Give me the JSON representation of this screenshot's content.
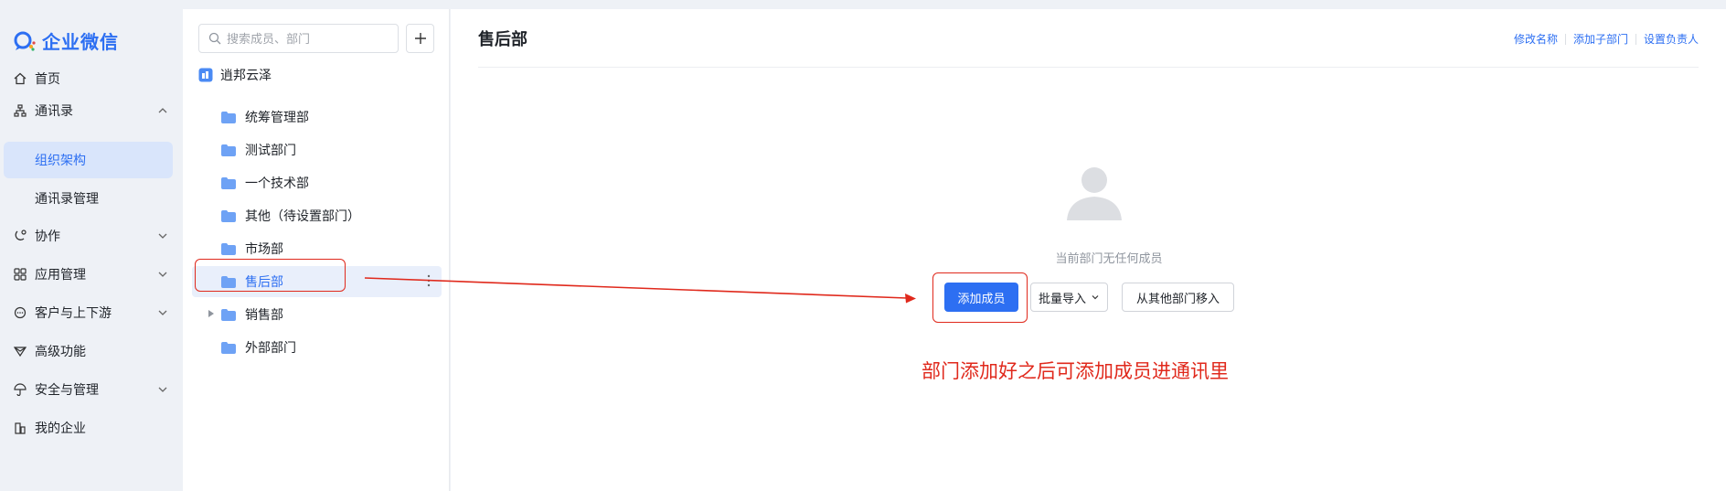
{
  "app": {
    "brand": "企业微信",
    "accent_color": "#2d6ff2",
    "annotation_color": "#e0291c"
  },
  "nav": {
    "items": [
      {
        "label": "首页",
        "icon": "home-icon"
      },
      {
        "label": "通讯录",
        "icon": "org-chart-icon",
        "expanded": true
      },
      {
        "label": "协作",
        "icon": "collaboration-icon"
      },
      {
        "label": "应用管理",
        "icon": "apps-grid-icon"
      },
      {
        "label": "客户与上下游",
        "icon": "chat-bubble-icon"
      },
      {
        "label": "高级功能",
        "icon": "diamond-icon"
      },
      {
        "label": "安全与管理",
        "icon": "umbrella-icon"
      },
      {
        "label": "我的企业",
        "icon": "building-icon"
      }
    ],
    "sub_items": [
      {
        "label": "组织架构",
        "selected": true
      },
      {
        "label": "通讯录管理"
      }
    ]
  },
  "dept_panel": {
    "search_placeholder": "搜索成员、部门",
    "root": "逍邦云泽",
    "departments": [
      {
        "label": "统筹管理部"
      },
      {
        "label": "测试部门"
      },
      {
        "label": "一个技术部"
      },
      {
        "label": "其他（待设置部门）"
      },
      {
        "label": "市场部"
      },
      {
        "label": "售后部",
        "selected": true
      },
      {
        "label": "销售部",
        "has_children": true
      },
      {
        "label": "外部部门"
      }
    ]
  },
  "main": {
    "title": "售后部",
    "links": [
      "修改名称",
      "添加子部门",
      "设置负责人"
    ],
    "empty_text": "当前部门无任何成员",
    "add_member": "添加成员",
    "batch_import": "批量导入",
    "move_from_other": "从其他部门移入"
  },
  "annotation": {
    "text": "部门添加好之后可添加成员进通讯里"
  }
}
